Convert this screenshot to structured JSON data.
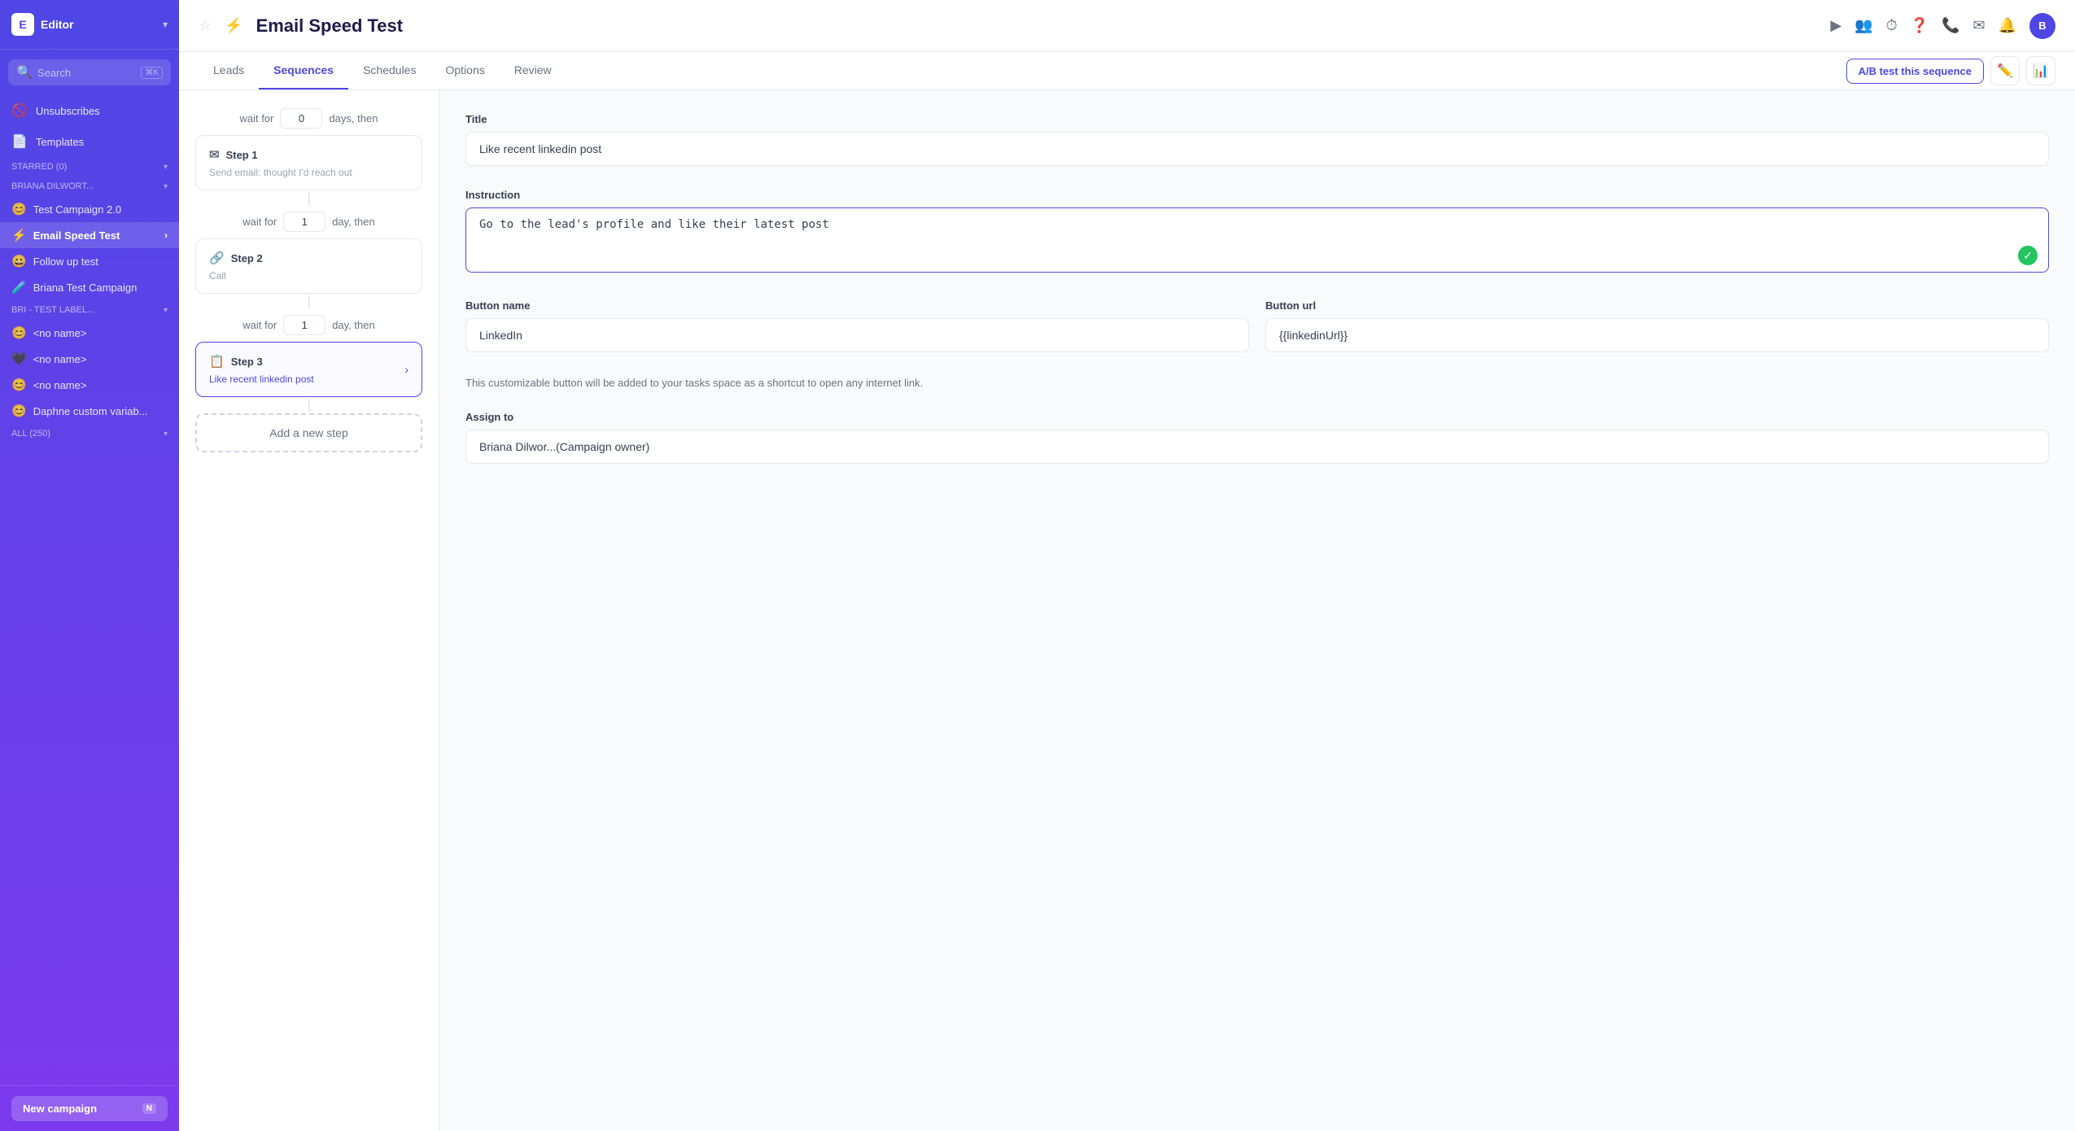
{
  "sidebar": {
    "logo": "E",
    "editor_label": "Editor",
    "search_placeholder": "Search",
    "search_shortcut": "⌘K",
    "nav_items": [
      {
        "id": "unsubscribes",
        "label": "Unsubscribes",
        "icon": "🚫"
      },
      {
        "id": "templates",
        "label": "Templates",
        "icon": "📄"
      }
    ],
    "starred_label": "STARRED (0)",
    "briana_label": "BRIANA DILWORT...",
    "campaigns": [
      {
        "id": "test-campaign-2",
        "label": "Test Campaign 2.0",
        "emoji": "😊",
        "active": false
      },
      {
        "id": "email-speed-test",
        "label": "Email Speed Test",
        "emoji": "⚡",
        "active": true
      },
      {
        "id": "follow-up-test",
        "label": "Follow up test",
        "emoji": "😀",
        "active": false
      },
      {
        "id": "briana-test-campaign",
        "label": "Briana Test Campaign",
        "emoji": "🧪",
        "active": false
      }
    ],
    "bri_label": "BRI - TEST LABEL...",
    "all_label": "ALL (250)",
    "leads": [
      {
        "id": "lead-1",
        "label": "<no name>",
        "emoji": "😊"
      },
      {
        "id": "lead-2",
        "label": "<no name>",
        "emoji": "🖤"
      },
      {
        "id": "lead-3",
        "label": "<no name>",
        "emoji": "😊"
      },
      {
        "id": "lead-4",
        "label": "Daphne custom variab...",
        "emoji": "😊"
      }
    ],
    "new_campaign_label": "New campaign",
    "new_campaign_shortcut": "N"
  },
  "topbar": {
    "title": "Email Speed Test",
    "bolt_icon": "⚡",
    "star_icon": "☆"
  },
  "tabs": {
    "items": [
      {
        "id": "leads",
        "label": "Leads",
        "active": false
      },
      {
        "id": "sequences",
        "label": "Sequences",
        "active": true
      },
      {
        "id": "schedules",
        "label": "Schedules",
        "active": false
      },
      {
        "id": "options",
        "label": "Options",
        "active": false
      },
      {
        "id": "review",
        "label": "Review",
        "active": false
      }
    ],
    "ab_test_label": "A/B test this sequence"
  },
  "sequence": {
    "steps": [
      {
        "id": "step1",
        "label": "Step 1",
        "icon": "✉",
        "subtitle": "Send email: thought I'd reach out",
        "wait_before": {
          "value": "0",
          "unit": "days, then"
        }
      },
      {
        "id": "step2",
        "label": "Step 2",
        "icon": "🔗",
        "subtitle": "Call",
        "wait_before": {
          "value": "1",
          "unit": "day, then"
        }
      },
      {
        "id": "step3",
        "label": "Step 3",
        "icon": "📋",
        "subtitle": "Like recent linkedin post",
        "selected": true,
        "wait_before": {
          "value": "1",
          "unit": "day, then"
        }
      }
    ],
    "add_step_label": "Add a new step"
  },
  "detail": {
    "title_label": "Title",
    "title_value": "Like recent linkedin post",
    "instruction_label": "Instruction",
    "instruction_value": "Go to the lead's profile and like their latest post",
    "button_name_label": "Button name",
    "button_name_value": "LinkedIn",
    "button_url_label": "Button url",
    "button_url_value": "{{linkedinUrl}}",
    "helper_text": "This customizable button will be added to your tasks space as a shortcut to open any internet link.",
    "assign_to_label": "Assign to",
    "assign_to_value": "Briana Dilwor...(Campaign owner)"
  }
}
